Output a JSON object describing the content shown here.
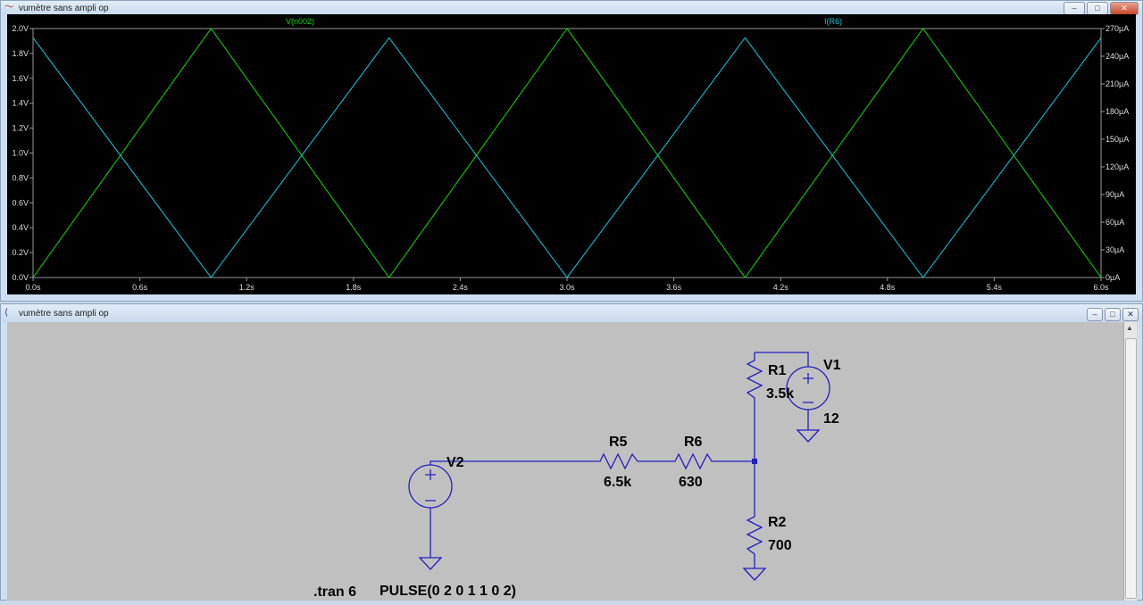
{
  "waveform_window": {
    "title": "vumètre sans ampli op",
    "controls": {
      "minimize": "–",
      "maximize": "□",
      "close": "✕"
    }
  },
  "schematic_window": {
    "title": "vumètre sans ampli op",
    "controls": {
      "minimize": "–",
      "maximize": "□",
      "close": "✕"
    }
  },
  "chart_data": {
    "type": "line",
    "xlabel": "",
    "x_ticks": [
      "0.0s",
      "0.6s",
      "1.2s",
      "1.8s",
      "2.4s",
      "3.0s",
      "3.6s",
      "4.2s",
      "4.8s",
      "5.4s",
      "6.0s"
    ],
    "xlim": [
      0,
      6
    ],
    "left_ticks": [
      "0.0V",
      "0.2V",
      "0.4V",
      "0.6V",
      "0.8V",
      "1.0V",
      "1.2V",
      "1.4V",
      "1.6V",
      "1.8V",
      "2.0V"
    ],
    "left_ylim": [
      0,
      2
    ],
    "right_ticks": [
      "0µA",
      "30µA",
      "60µA",
      "90µA",
      "120µA",
      "150µA",
      "180µA",
      "210µA",
      "240µA",
      "270µA"
    ],
    "right_ylim": [
      0,
      270
    ],
    "grid": false,
    "series": [
      {
        "name": "V(n002)",
        "axis": "left",
        "color": "#00e000",
        "x": [
          0,
          1,
          2,
          3,
          4,
          5,
          6
        ],
        "y": [
          0,
          2,
          0,
          2,
          0,
          2,
          0
        ]
      },
      {
        "name": "I(R6)",
        "axis": "right",
        "color": "#00d0e0",
        "x": [
          0,
          1,
          2,
          3,
          4,
          5,
          6
        ],
        "y": [
          260,
          0,
          260,
          0,
          260,
          0,
          260
        ]
      }
    ]
  },
  "schematic": {
    "V1": {
      "name": "V1",
      "value": "12"
    },
    "V2": {
      "name": "V2",
      "value": "PULSE(0 2 0 1 1 0 2)"
    },
    "R1": {
      "name": "R1",
      "value": "3.5k"
    },
    "R2": {
      "name": "R2",
      "value": "700"
    },
    "R5": {
      "name": "R5",
      "value": "6.5k"
    },
    "R6": {
      "name": "R6",
      "value": "630"
    },
    "directive": ".tran 6",
    "wire_color": "#2020c0"
  }
}
